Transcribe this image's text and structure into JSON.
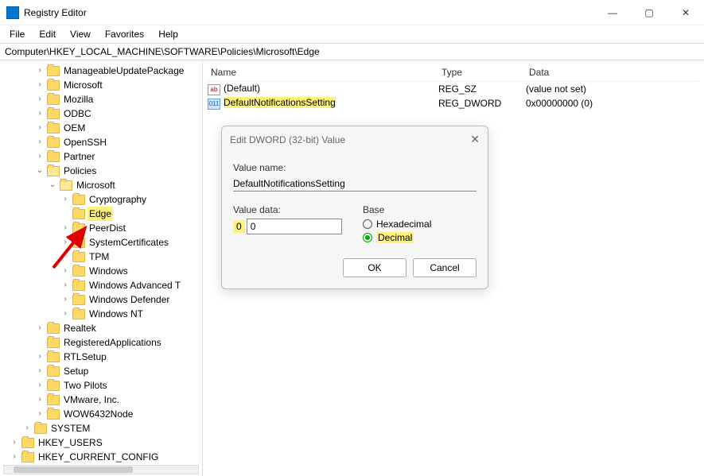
{
  "window": {
    "title": "Registry Editor"
  },
  "menus": [
    "File",
    "Edit",
    "View",
    "Favorites",
    "Help"
  ],
  "address": "Computer\\HKEY_LOCAL_MACHINE\\SOFTWARE\\Policies\\Microsoft\\Edge",
  "tree": {
    "items": [
      {
        "label": "ManageableUpdatePackage",
        "exp": ">"
      },
      {
        "label": "Microsoft",
        "exp": ">"
      },
      {
        "label": "Mozilla",
        "exp": ">"
      },
      {
        "label": "ODBC",
        "exp": ">"
      },
      {
        "label": "OEM",
        "exp": ">"
      },
      {
        "label": "OpenSSH",
        "exp": ">"
      },
      {
        "label": "Partner",
        "exp": ">"
      },
      {
        "label": "Policies",
        "exp": "v",
        "open": true,
        "children": [
          {
            "label": "Microsoft",
            "exp": "v",
            "open": true,
            "children": [
              {
                "label": "Cryptography",
                "exp": ">"
              },
              {
                "label": "Edge",
                "exp": "",
                "hl": true
              },
              {
                "label": "PeerDist",
                "exp": ">"
              },
              {
                "label": "SystemCertificates",
                "exp": ">"
              },
              {
                "label": "TPM",
                "exp": ""
              },
              {
                "label": "Windows",
                "exp": ">"
              },
              {
                "label": "Windows Advanced T",
                "exp": ">"
              },
              {
                "label": "Windows Defender",
                "exp": ">"
              },
              {
                "label": "Windows NT",
                "exp": ">"
              }
            ]
          }
        ]
      },
      {
        "label": "Realtek",
        "exp": ">"
      },
      {
        "label": "RegisteredApplications",
        "exp": ""
      },
      {
        "label": "RTLSetup",
        "exp": ">"
      },
      {
        "label": "Setup",
        "exp": ">"
      },
      {
        "label": "Two Pilots",
        "exp": ">"
      },
      {
        "label": "VMware, Inc.",
        "exp": ">"
      },
      {
        "label": "WOW6432Node",
        "exp": ">"
      }
    ],
    "tail": [
      {
        "label": "SYSTEM",
        "exp": ">"
      },
      {
        "label": "HKEY_USERS",
        "exp": ">"
      },
      {
        "label": "HKEY_CURRENT_CONFIG",
        "exp": ">"
      }
    ]
  },
  "columns": {
    "name": "Name",
    "type": "Type",
    "data": "Data"
  },
  "values": [
    {
      "name": "(Default)",
      "type": "REG_SZ",
      "data": "(value not set)",
      "icon": "ab"
    },
    {
      "name": "DefaultNotificationsSetting",
      "type": "REG_DWORD",
      "data": "0x00000000 (0)",
      "icon": "dw",
      "hl": true
    }
  ],
  "dialog": {
    "title": "Edit DWORD (32-bit) Value",
    "valueNameLabel": "Value name:",
    "valueName": "DefaultNotificationsSetting",
    "valueDataLabel": "Value data:",
    "valueData": "0",
    "baseLabel": "Base",
    "hex": "Hexadecimal",
    "dec": "Decimal",
    "ok": "OK",
    "cancel": "Cancel"
  }
}
